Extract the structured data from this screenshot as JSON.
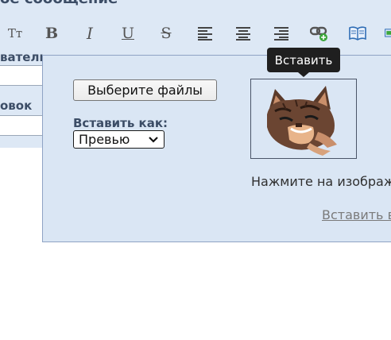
{
  "header": {
    "title": "ое сообщение"
  },
  "toolbar": {
    "buttons": [
      {
        "id": "font-size",
        "glyph": "Tт"
      },
      {
        "id": "bold",
        "glyph": "B"
      },
      {
        "id": "italic",
        "glyph": "I"
      },
      {
        "id": "underline",
        "glyph": "U"
      },
      {
        "id": "strike",
        "glyph": "S"
      }
    ]
  },
  "form": {
    "author_label": "ватель",
    "title_label": "овок"
  },
  "upload_panel": {
    "choose_files_label": "Выберите файлы",
    "insert_as_label": "Вставить как:",
    "insert_as_value": "Превью",
    "tooltip": "Вставить",
    "hint": "Нажмите на изображ",
    "insert_link": "Вставить в"
  },
  "colors": {
    "panel_bg": "#dae6f4",
    "label_color": "#3c4d66",
    "tooltip_bg": "#1f1f1f"
  }
}
